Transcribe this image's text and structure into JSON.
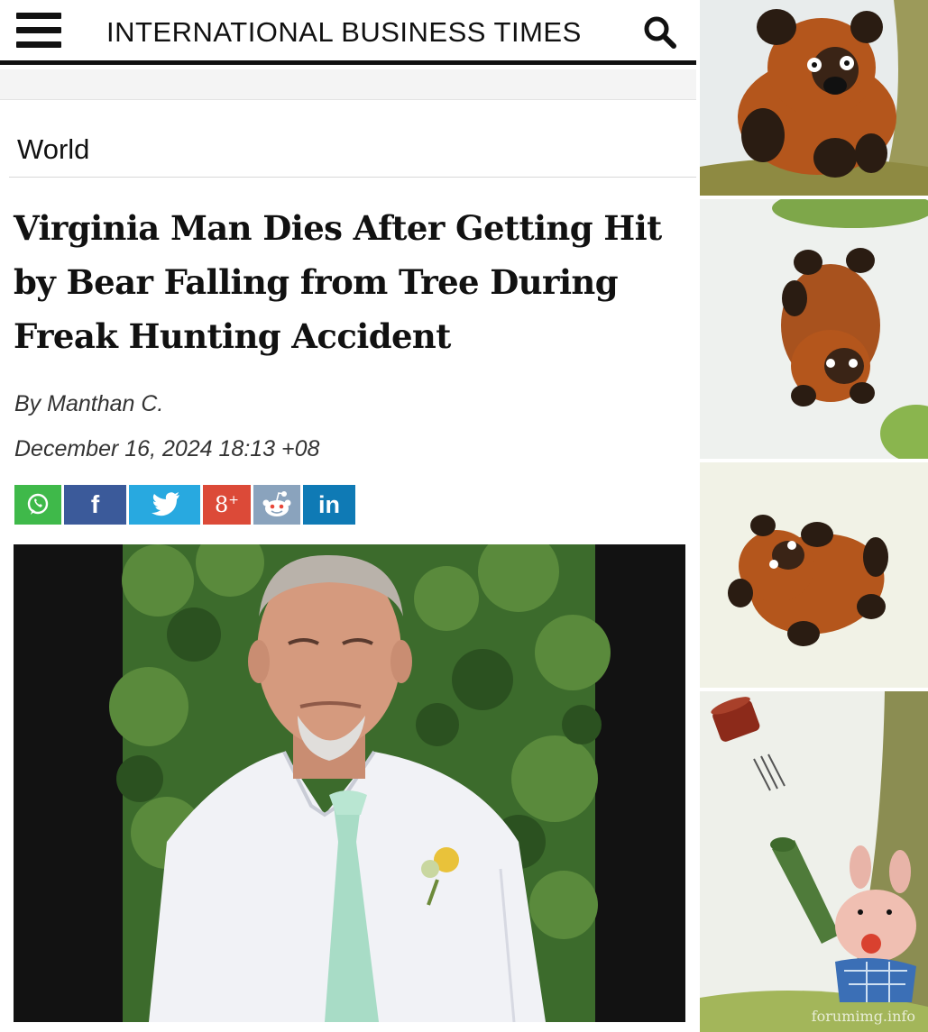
{
  "header": {
    "site_title": "INTERNATIONAL BUSINESS TIMES",
    "menu_icon": "hamburger-menu-icon",
    "search_icon": "search-icon"
  },
  "article": {
    "section": "World",
    "headline": "Virginia Man Dies After Getting Hit by Bear Falling from Tree During Freak Hunting Accident",
    "byline_prefix": "By",
    "author": "Manthan C.",
    "date": "December 16, 2024 18:13 +08"
  },
  "share": [
    {
      "network": "WhatsApp",
      "icon": "whatsapp-icon",
      "label": "",
      "color": "#3fb94a"
    },
    {
      "network": "Facebook",
      "icon": "facebook-icon",
      "label": "f",
      "color": "#3b5a9a"
    },
    {
      "network": "Twitter",
      "icon": "twitter-icon",
      "label": "",
      "color": "#28a9e0"
    },
    {
      "network": "Google Plus",
      "icon": "google-plus-icon",
      "label": "8",
      "color": "#dc4a38"
    },
    {
      "network": "Reddit",
      "icon": "reddit-icon",
      "label": "",
      "color": "#8aa3bd"
    },
    {
      "network": "LinkedIn",
      "icon": "linkedin-icon",
      "label": "in",
      "color": "#0f7ab5"
    }
  ],
  "comic": {
    "watermark": "forumimg.info"
  },
  "colors": {
    "text": "#111111",
    "header_rule": "#111111",
    "photo_frame": "#121212"
  }
}
